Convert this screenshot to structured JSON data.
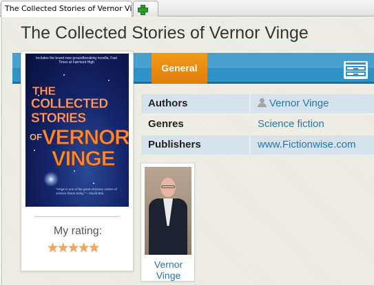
{
  "tabs": {
    "active_label": "The Collected Stories of Vernor Vinge",
    "add_icon": "plus-icon"
  },
  "book": {
    "title": "The Collected Stories of Vernor Vinge",
    "cover": {
      "blurb": "Includes the brand-new groundbreaking novella, Fast Times at Fairmont High",
      "line_the": "THE",
      "line_collected": "COLLECTED",
      "line_stories": "STORIES",
      "line_of": "OF",
      "line_vernor": "VERNOR",
      "line_vinge": "VINGE",
      "quote": "\"Vinge is one of the great visionary writers of science fiction today.\" —David Brin"
    }
  },
  "section_tab": {
    "label": "General"
  },
  "rating": {
    "label": "My rating:",
    "value": 5,
    "max": 5
  },
  "details": {
    "rows": [
      {
        "label": "Authors",
        "value": "Vernor Vinge",
        "icon": "person-icon"
      },
      {
        "label": "Genres",
        "value": "Science fiction"
      },
      {
        "label": "Publishers",
        "value": "www.Fictionwise.com"
      }
    ]
  },
  "author_card": {
    "name_line1": "Vernor",
    "name_line2": "Vinge"
  },
  "colors": {
    "accent_blue": "#2f93c8",
    "tab_orange": "#f08c14",
    "link": "#2677b0"
  }
}
